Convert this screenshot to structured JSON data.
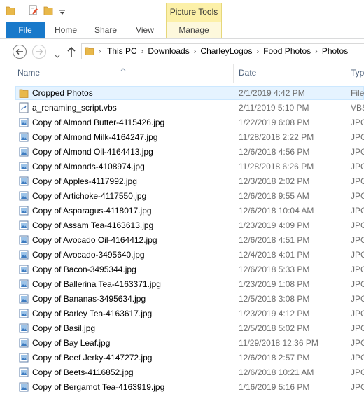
{
  "ribbon": {
    "contextual_label": "Picture Tools",
    "tabs": [
      "File",
      "Home",
      "Share",
      "View",
      "Manage"
    ]
  },
  "address": {
    "crumbs": [
      "This PC",
      "Downloads",
      "CharleyLogos",
      "Food Photos",
      "Photos"
    ]
  },
  "columns": {
    "name": "Name",
    "date": "Date",
    "type": "Typ"
  },
  "files": [
    {
      "name": "Cropped Photos",
      "date": "2/1/2019 4:42 PM",
      "type": "File",
      "icon": "folder-icon",
      "selected": true
    },
    {
      "name": "a_renaming_script.vbs",
      "date": "2/11/2019 5:10 PM",
      "type": "VBS",
      "icon": "script-icon"
    },
    {
      "name": "Copy of Almond Butter-4115426.jpg",
      "date": "1/22/2019 6:08 PM",
      "type": "JPG",
      "icon": "image-icon"
    },
    {
      "name": "Copy of Almond Milk-4164247.jpg",
      "date": "11/28/2018 2:22 PM",
      "type": "JPG",
      "icon": "image-icon"
    },
    {
      "name": "Copy of Almond Oil-4164413.jpg",
      "date": "12/6/2018 4:56 PM",
      "type": "JPG",
      "icon": "image-icon"
    },
    {
      "name": "Copy of Almonds-4108974.jpg",
      "date": "11/28/2018 6:26 PM",
      "type": "JPG",
      "icon": "image-icon"
    },
    {
      "name": "Copy of Apples-4117992.jpg",
      "date": "12/3/2018 2:02 PM",
      "type": "JPG",
      "icon": "image-icon"
    },
    {
      "name": "Copy of Artichoke-4117550.jpg",
      "date": "12/6/2018 9:55 AM",
      "type": "JPG",
      "icon": "image-icon"
    },
    {
      "name": "Copy of Asparagus-4118017.jpg",
      "date": "12/6/2018 10:04 AM",
      "type": "JPG",
      "icon": "image-icon"
    },
    {
      "name": "Copy of Assam Tea-4163613.jpg",
      "date": "1/23/2019 4:09 PM",
      "type": "JPG",
      "icon": "image-icon"
    },
    {
      "name": "Copy of Avocado Oil-4164412.jpg",
      "date": "12/6/2018 4:51 PM",
      "type": "JPG",
      "icon": "image-icon"
    },
    {
      "name": "Copy of Avocado-3495640.jpg",
      "date": "12/4/2018 4:01 PM",
      "type": "JPG",
      "icon": "image-icon"
    },
    {
      "name": "Copy of Bacon-3495344.jpg",
      "date": "12/6/2018 5:33 PM",
      "type": "JPG",
      "icon": "image-icon"
    },
    {
      "name": "Copy of Ballerina Tea-4163371.jpg",
      "date": "1/23/2019 1:08 PM",
      "type": "JPG",
      "icon": "image-icon"
    },
    {
      "name": "Copy of Bananas-3495634.jpg",
      "date": "12/5/2018 3:08 PM",
      "type": "JPG",
      "icon": "image-icon"
    },
    {
      "name": "Copy of Barley Tea-4163617.jpg",
      "date": "1/23/2019 4:12 PM",
      "type": "JPG",
      "icon": "image-icon"
    },
    {
      "name": "Copy of Basil.jpg",
      "date": "12/5/2018 5:02 PM",
      "type": "JPG",
      "icon": "image-icon"
    },
    {
      "name": "Copy of Bay Leaf.jpg",
      "date": "11/29/2018 12:36 PM",
      "type": "JPG",
      "icon": "image-icon"
    },
    {
      "name": "Copy of Beef Jerky-4147272.jpg",
      "date": "12/6/2018 2:57 PM",
      "type": "JPG",
      "icon": "image-icon"
    },
    {
      "name": "Copy of Beets-4116852.jpg",
      "date": "12/6/2018 10:21 AM",
      "type": "JPG",
      "icon": "image-icon"
    },
    {
      "name": "Copy of Bergamot Tea-4163919.jpg",
      "date": "1/16/2019 5:16 PM",
      "type": "JPG",
      "icon": "image-icon"
    }
  ]
}
